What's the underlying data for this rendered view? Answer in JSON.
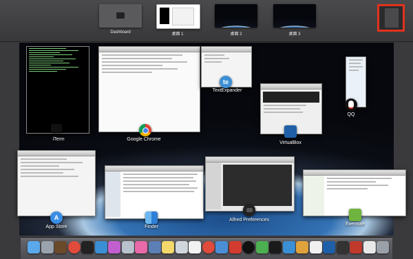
{
  "spaces": [
    {
      "label": "Dashboard"
    },
    {
      "label": "桌面 1"
    },
    {
      "label": "桌面 2"
    },
    {
      "label": "桌面 3"
    }
  ],
  "windows": [
    {
      "name": "iterm",
      "label": "iTerm"
    },
    {
      "name": "google-chrome",
      "label": "Google Chrome"
    },
    {
      "name": "textexpander",
      "label": "TextExpander"
    },
    {
      "name": "virtualbox",
      "label": "VirtualBox"
    },
    {
      "name": "qq",
      "label": "QQ"
    },
    {
      "name": "app-store",
      "label": "App Store"
    },
    {
      "name": "finder",
      "label": "Finder"
    },
    {
      "name": "alfred-preferences",
      "label": "Alfred Preferences"
    },
    {
      "name": "evernote",
      "label": "Evernote"
    }
  ],
  "colors": {
    "add_space_border": "#e2321d",
    "terminal_bg": "#000000",
    "terminal_text": "#7fd37f"
  },
  "dock_icons": [
    "finder-icon",
    "launchpad-icon",
    "photo-icon",
    "chrome-icon",
    "terminal-icon",
    "safari-icon",
    "flower-icon",
    "mail-icon",
    "z-icon",
    "pencil-icon",
    "notes-icon",
    "grid-icon",
    "textedit-icon",
    "chrome2-icon",
    "app-icon",
    "red-icon",
    "qq-icon",
    "green-icon",
    "activity-icon",
    "te-icon",
    "folder-icon",
    "calendar-icon",
    "virtualbox-icon",
    "alfred-icon",
    "ruby-icon",
    "docs-icon",
    "trash-icon"
  ]
}
